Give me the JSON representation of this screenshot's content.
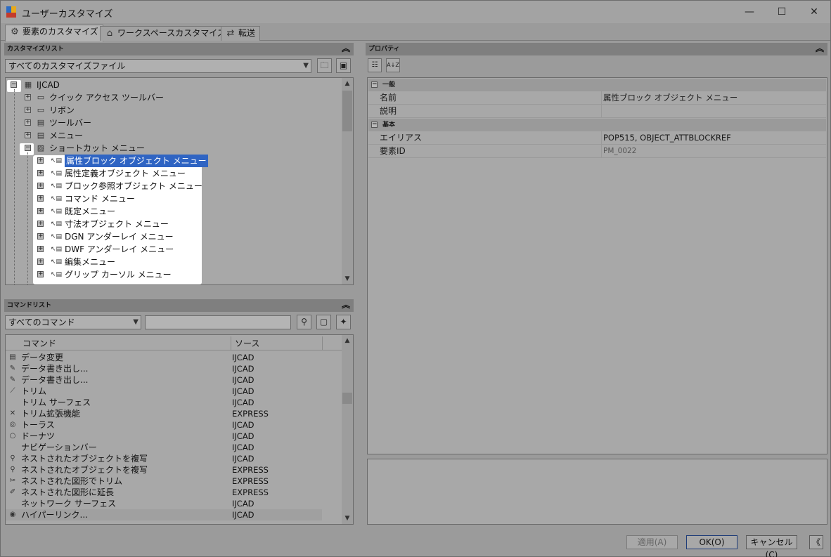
{
  "window": {
    "title": "ユーザーカスタマイズ",
    "minimize": "—",
    "maximize": "☐",
    "close": "✕"
  },
  "tabs": [
    {
      "label": "要素のカスタマイズ",
      "icon": "⚙"
    },
    {
      "label": "ワークスペースカスタマイズ",
      "icon": "⌂"
    },
    {
      "label": "転送",
      "icon": "⇄"
    }
  ],
  "custom_list": {
    "header": "カスタマイズリスト",
    "collapse": "︽",
    "file_combo": "すべてのカスタマイズファイル",
    "tree": [
      {
        "label": "IJCAD",
        "level": 0,
        "expander": "−"
      },
      {
        "label": "クイック アクセス ツールバー",
        "level": 1,
        "expander": "+"
      },
      {
        "label": "リボン",
        "level": 1,
        "expander": "+"
      },
      {
        "label": "ツールバー",
        "level": 1,
        "expander": "+"
      },
      {
        "label": "メニュー",
        "level": 1,
        "expander": "+"
      },
      {
        "label": "ショートカット メニュー",
        "level": 1,
        "expander": "−"
      },
      {
        "label": "属性ブロック オブジェクト メニュー",
        "level": 2,
        "expander": "+",
        "selected": true
      },
      {
        "label": "属性定義オブジェクト メニュー",
        "level": 2,
        "expander": "+"
      },
      {
        "label": "ブロック参照オブジェクト メニュー",
        "level": 2,
        "expander": "+"
      },
      {
        "label": "コマンド メニュー",
        "level": 2,
        "expander": "+"
      },
      {
        "label": "既定メニュー",
        "level": 2,
        "expander": "+"
      },
      {
        "label": "寸法オブジェクト メニュー",
        "level": 2,
        "expander": "+"
      },
      {
        "label": "DGN アンダーレイ メニュー",
        "level": 2,
        "expander": "+"
      },
      {
        "label": "DWF アンダーレイ メニュー",
        "level": 2,
        "expander": "+"
      },
      {
        "label": "編集メニュー",
        "level": 2,
        "expander": "+"
      },
      {
        "label": "グリップ カーソル メニュー",
        "level": 2,
        "expander": "+"
      }
    ]
  },
  "command_list": {
    "header": "コマンドリスト",
    "collapse": "︽",
    "filter_combo": "すべてのコマンド",
    "search_value": "",
    "col_command": "コマンド",
    "col_source": "ソース",
    "rows": [
      {
        "cmd": "データ変更",
        "src": "IJCAD",
        "icon": "▤"
      },
      {
        "cmd": "データ書き出し...",
        "src": "IJCAD",
        "icon": "✎"
      },
      {
        "cmd": "データ書き出し...",
        "src": "IJCAD",
        "icon": "✎"
      },
      {
        "cmd": "トリム",
        "src": "IJCAD",
        "icon": "⟋"
      },
      {
        "cmd": "トリム サーフェス",
        "src": "IJCAD",
        "icon": ""
      },
      {
        "cmd": "トリム拡張機能",
        "src": "EXPRESS",
        "icon": "✕"
      },
      {
        "cmd": "トーラス",
        "src": "IJCAD",
        "icon": "◎"
      },
      {
        "cmd": "ドーナツ",
        "src": "IJCAD",
        "icon": "○"
      },
      {
        "cmd": "ナビゲーションバー",
        "src": "IJCAD",
        "icon": ""
      },
      {
        "cmd": "ネストされたオブジェクトを複写",
        "src": "IJCAD",
        "icon": "⚲"
      },
      {
        "cmd": "ネストされたオブジェクトを複写",
        "src": "EXPRESS",
        "icon": "⚲"
      },
      {
        "cmd": "ネストされた図形でトリム",
        "src": "EXPRESS",
        "icon": "✂"
      },
      {
        "cmd": "ネストされた図形に延長",
        "src": "EXPRESS",
        "icon": "✐"
      },
      {
        "cmd": "ネットワーク サーフェス",
        "src": "IJCAD",
        "icon": ""
      },
      {
        "cmd": "ハイパーリンク...",
        "src": "IJCAD",
        "icon": "◉"
      }
    ]
  },
  "properties": {
    "header": "プロパティ",
    "collapse": "︽",
    "sort_icon": "A↓Z",
    "categories": [
      {
        "label": "一般",
        "expander": "−",
        "rows": [
          {
            "name": "名前",
            "value": "属性ブロック オブジェクト メニュー"
          },
          {
            "name": "説明",
            "value": ""
          }
        ]
      },
      {
        "label": "基本",
        "expander": "−",
        "rows": [
          {
            "name": "エイリアス",
            "value": "POP515, OBJECT_ATTBLOCKREF"
          },
          {
            "name": "要素ID",
            "value": "PM_0022"
          }
        ]
      }
    ]
  },
  "footer": {
    "apply": "適用(A)",
    "ok": "OK(O)",
    "cancel": "キャンセル(C)",
    "collapse": "《"
  }
}
